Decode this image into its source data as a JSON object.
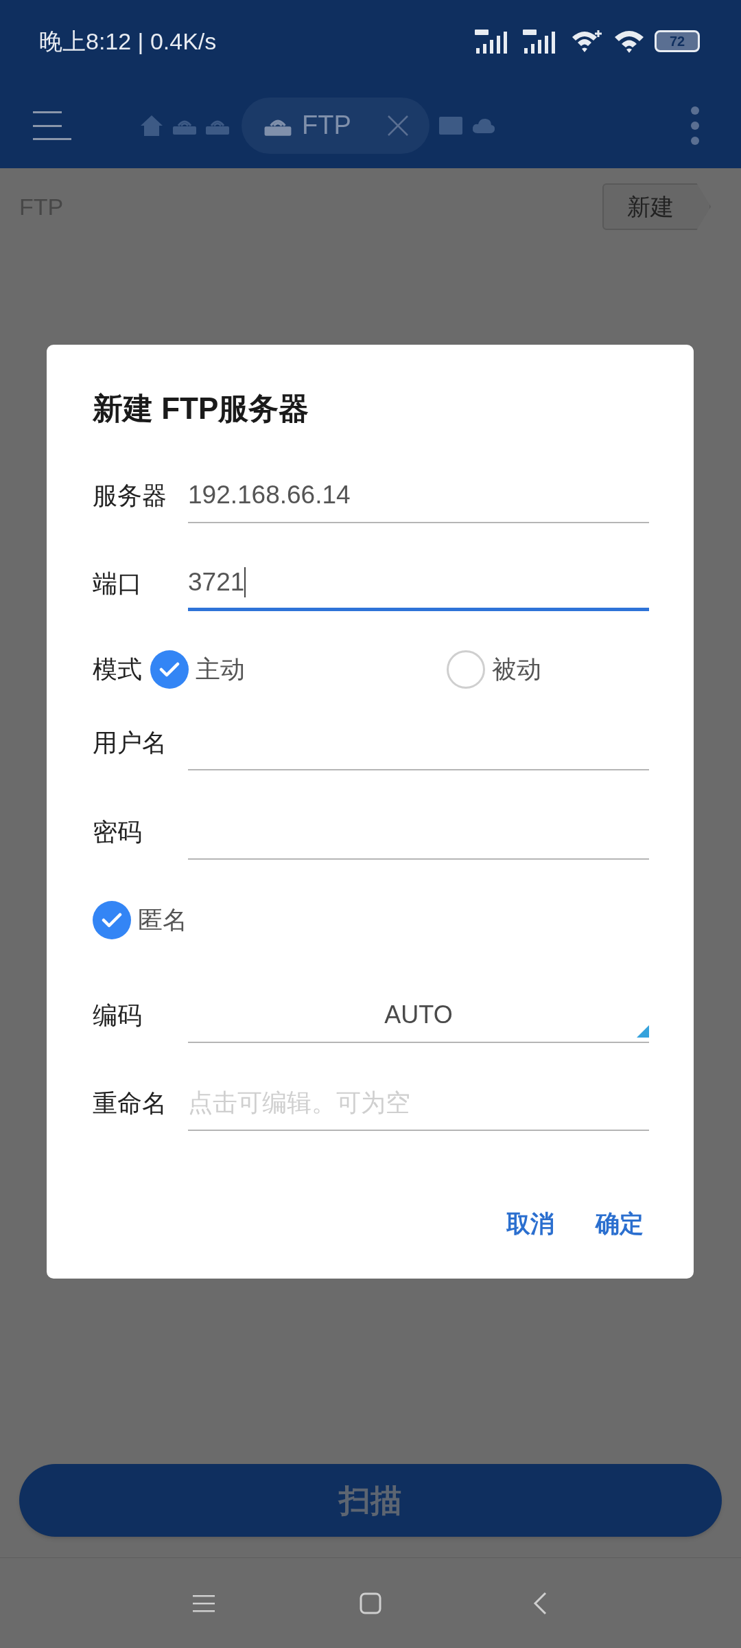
{
  "status_bar": {
    "time": "晚上8:12 | 0.4K/s",
    "battery": "72"
  },
  "app_bar": {
    "active_tab": {
      "label": "FTP"
    }
  },
  "breadcrumb": "FTP",
  "new_button": "新建",
  "dialog": {
    "title": "新建 FTP服务器",
    "fields": [
      {
        "kind": "text",
        "label": "服务器",
        "value": "192.168.66.14",
        "focused": false
      },
      {
        "kind": "text",
        "label": "端口",
        "value": "3721",
        "focused": true
      },
      {
        "kind": "radio",
        "label": "模式",
        "options": [
          {
            "label": "主动",
            "selected": true
          },
          {
            "label": "被动",
            "selected": false
          }
        ]
      },
      {
        "kind": "text",
        "label": "用户名",
        "focused": false
      },
      {
        "kind": "text",
        "label": "密码",
        "focused": false
      },
      {
        "kind": "checkbox",
        "label": "匿名",
        "checked": true
      },
      {
        "kind": "select",
        "label": "编码",
        "value": "AUTO"
      },
      {
        "kind": "text",
        "label": "重命名",
        "placeholder": "点击可编辑。可为空",
        "focused": false
      }
    ],
    "buttons": [
      "取消",
      "确定"
    ]
  },
  "scan_button": "扫描"
}
